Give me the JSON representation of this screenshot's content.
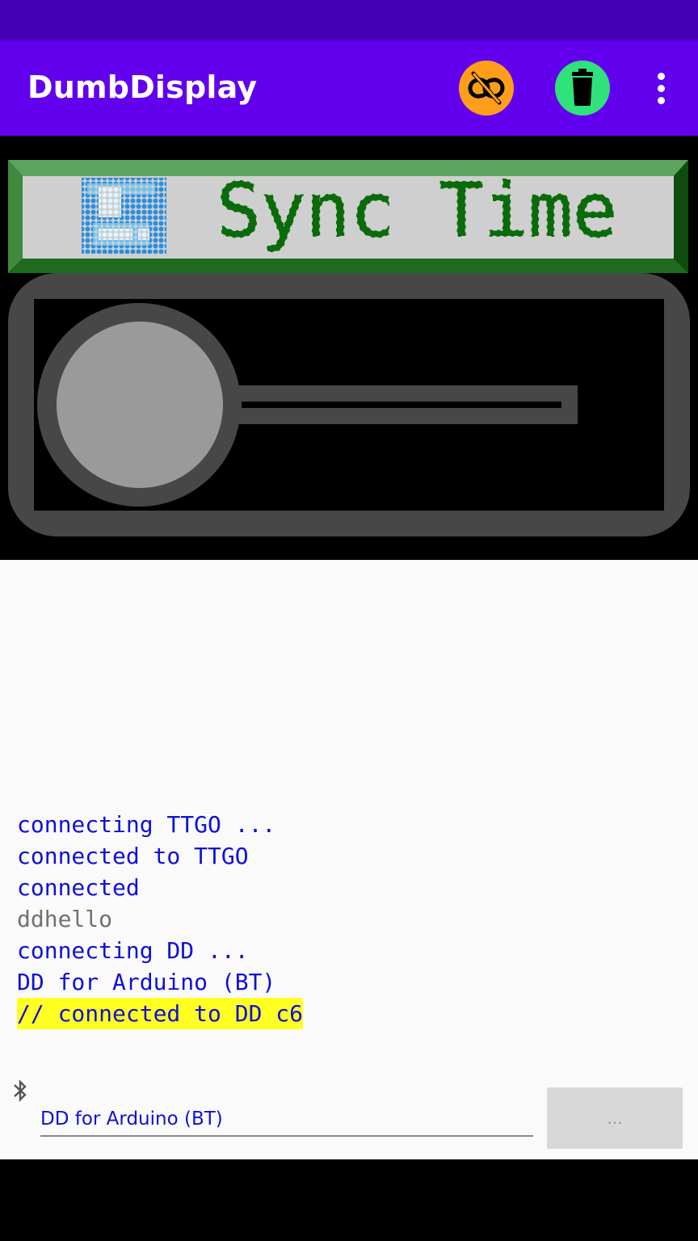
{
  "app_bar": {
    "title": "DumbDisplay",
    "buttons": [
      {
        "icon": "link-off-icon",
        "color": "#ff9e1a"
      },
      {
        "icon": "trash-icon",
        "color": "#2fe27a"
      },
      {
        "icon": "more-vert-icon"
      }
    ]
  },
  "lcd_banner": {
    "text": "Sync Time",
    "icon": "floppy-disk-icon",
    "text_color": "#006400",
    "background": "#cfcfcf",
    "frame_color": "#4e9a4e"
  },
  "slider": {
    "knob_color": "#9a9a9a",
    "frame_color": "#474747",
    "value": 0
  },
  "log": {
    "lines": [
      {
        "text": "connecting TTGO ...",
        "style": "blue"
      },
      {
        "text": "connected to TTGO",
        "style": "blue"
      },
      {
        "text": "connected",
        "style": "blue"
      },
      {
        "text": "ddhello",
        "style": "gray"
      },
      {
        "text": "connecting DD ...",
        "style": "blue"
      },
      {
        "text": "DD for Arduino (BT)",
        "style": "blue"
      },
      {
        "text": "// connected to DD c6",
        "style": "highlight"
      }
    ]
  },
  "connection": {
    "icon": "bluetooth-icon",
    "device_name": "DD for Arduino (BT)",
    "more_button_label": "..."
  }
}
